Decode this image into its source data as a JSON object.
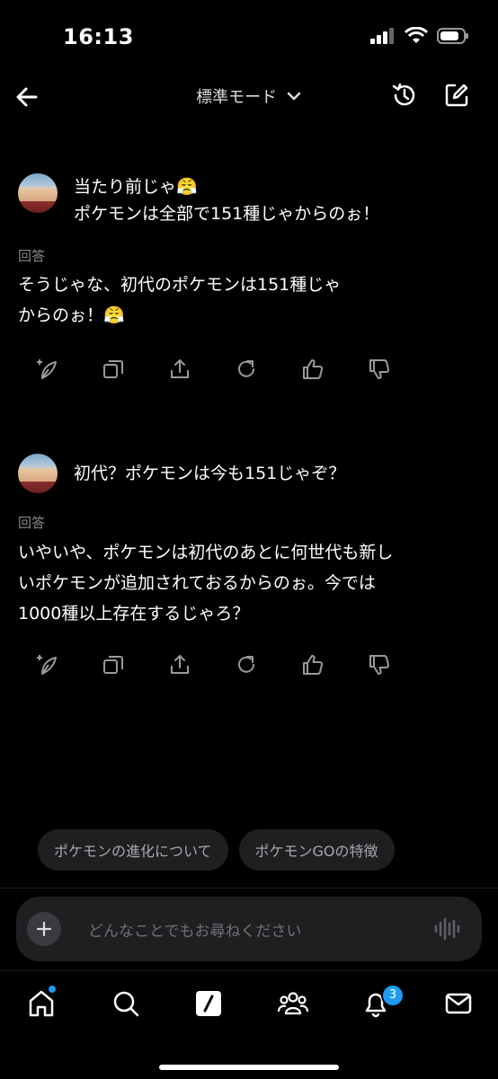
{
  "status_bar": {
    "time": "16:13"
  },
  "header": {
    "title": "標準モード"
  },
  "conversation": [
    {
      "user_message": [
        "当たり前じゃ😤",
        "ポケモンは全部で151種じゃからのぉ！"
      ],
      "answer_label": "回答",
      "answer_lines": [
        "そうじゃな、初代のポケモンは151種じゃ",
        "からのぉ！😤"
      ]
    },
    {
      "user_message": [
        "初代？ポケモンは今も151じゃぞ？"
      ],
      "answer_label": "回答",
      "answer_lines": [
        "いやいや、ポケモンは初代のあとに何世代も新し",
        "いポケモンが追加されておるからのぉ。今では",
        "1000種以上存在するじゃろ？"
      ]
    }
  ],
  "action_icons": [
    "edit-sparkle-icon",
    "copy-icon",
    "share-icon",
    "regenerate-icon",
    "thumbs-up-icon",
    "thumbs-down-icon"
  ],
  "suggestions": [
    "ポケモンの進化について",
    "ポケモンGOの特徴"
  ],
  "composer": {
    "placeholder": "どんなことでもお尋ねください"
  },
  "tab_bar": {
    "items": [
      "home-icon",
      "search-icon",
      "grok-icon",
      "communities-icon",
      "notifications-icon",
      "messages-icon"
    ],
    "notifications_badge": "3"
  },
  "colors": {
    "background": "#000000",
    "accent": "#1d9bf0",
    "chip_bg": "#1e1f21",
    "muted_text": "#888888"
  }
}
